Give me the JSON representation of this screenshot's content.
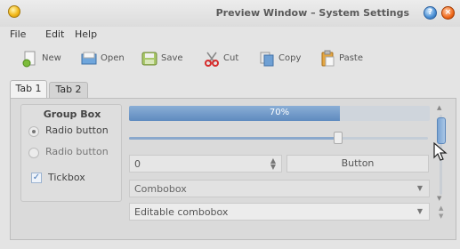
{
  "window": {
    "title": "Preview Window – System Settings",
    "help_button": "?",
    "close_button": "×"
  },
  "menu": [
    {
      "label": "File"
    },
    {
      "label": "Edit"
    },
    {
      "label": "Help"
    }
  ],
  "toolbar": [
    {
      "label": "New",
      "icon": "new-document-icon"
    },
    {
      "label": "Open",
      "icon": "open-folder-icon"
    },
    {
      "label": "Save",
      "icon": "save-icon"
    },
    {
      "label": "Cut",
      "icon": "scissors-icon"
    },
    {
      "label": "Copy",
      "icon": "copy-icon"
    },
    {
      "label": "Paste",
      "icon": "paste-icon"
    }
  ],
  "tabs": [
    {
      "label": "Tab 1",
      "active": true
    },
    {
      "label": "Tab 2",
      "active": false
    }
  ],
  "group_box": {
    "title": "Group Box",
    "radio1": "Radio button",
    "radio2": "Radio button",
    "checkbox": "Tickbox",
    "checkbox_checked": true
  },
  "progress": {
    "value": 0.7,
    "text": "70%"
  },
  "slider": {
    "value": 0.7
  },
  "spinbox": {
    "value": "0"
  },
  "button": {
    "label": "Button"
  },
  "combobox": {
    "value": "Combobox"
  },
  "editable_combobox": {
    "value": "Editable combobox"
  },
  "colors": {
    "accent": "#5f8bbf",
    "titlebar_help": "#4a8fd4",
    "titlebar_close": "#f06a1c"
  }
}
